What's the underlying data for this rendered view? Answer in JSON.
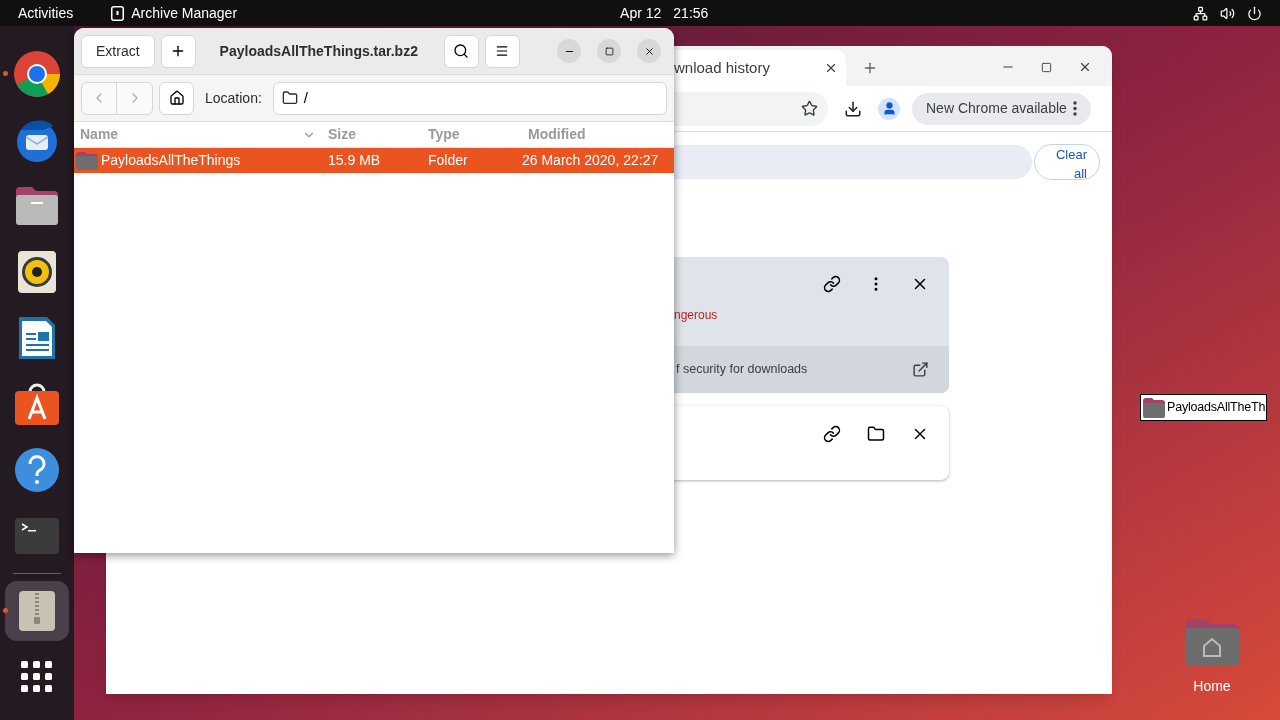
{
  "top_bar": {
    "activities": "Activities",
    "app_name": "Archive Manager",
    "date": "Apr 12",
    "time": "21:56"
  },
  "dock": {
    "items": [
      {
        "kind": "browser",
        "running": true,
        "active": false
      },
      {
        "kind": "mail",
        "running": false,
        "active": false
      },
      {
        "kind": "files",
        "running": false,
        "active": false
      },
      {
        "kind": "music",
        "running": false,
        "active": false
      },
      {
        "kind": "writer",
        "running": false,
        "active": false
      },
      {
        "kind": "store",
        "running": false,
        "active": false
      },
      {
        "kind": "help",
        "running": false,
        "active": false
      },
      {
        "kind": "terminal",
        "running": false,
        "active": false
      },
      {
        "kind": "separator"
      },
      {
        "kind": "archive",
        "running": true,
        "active": true
      },
      {
        "kind": "grid",
        "running": false,
        "active": false
      }
    ]
  },
  "browser_window": {
    "tab_title": "wnload history",
    "update_button": "New Chrome available",
    "clear_button": "Clear all",
    "downloads": [
      {
        "kind": "dangerous",
        "status": "ngerous",
        "footer": "f security for downloads"
      },
      {
        "kind": "complete"
      }
    ]
  },
  "archive_window": {
    "extract_button": "Extract",
    "title": "PayloadsAllTheThings.tar.bz2",
    "location_label": "Location:",
    "location": "/",
    "columns": [
      "Name",
      "Size",
      "Type",
      "Modified"
    ],
    "rows": [
      {
        "name": "PayloadsAllTheThings",
        "size": "15.9 MB",
        "type": "Folder",
        "modified": "26 March 2020, 22:27",
        "selected": true
      }
    ]
  },
  "desktop": {
    "icons": [
      {
        "kind": "folder",
        "label": "PayloadsAllTheTh",
        "selected": true
      },
      {
        "kind": "home",
        "label": "Home",
        "selected": false
      }
    ]
  }
}
